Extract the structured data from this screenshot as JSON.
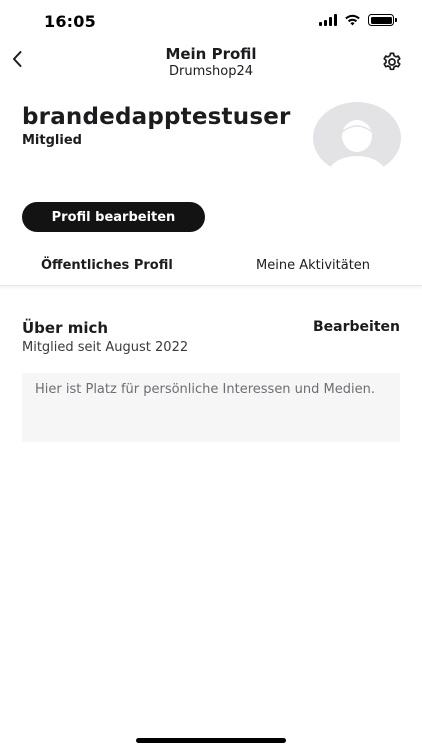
{
  "status_bar": {
    "time": "16:05",
    "battery_fill": 1.0
  },
  "nav": {
    "title": "Mein Profil",
    "subtitle": "Drumshop24",
    "back_icon": "chevron-left-icon",
    "settings_icon": "gear-icon"
  },
  "profile": {
    "username": "brandedapptestuser",
    "role": "Mitglied",
    "avatar_icon": "avatar-placeholder-icon",
    "edit_button_label": "Profil bearbeiten"
  },
  "tabs": [
    {
      "label": "Öffentliches Profil",
      "selected": true
    },
    {
      "label": "Meine Aktivitäten",
      "selected": false
    }
  ],
  "about": {
    "title": "Über mich",
    "edit_label": "Bearbeiten",
    "member_since": "Mitglied seit August 2022",
    "placeholder_text": "Hier ist Platz für persönliche Interessen und Medien."
  },
  "colors": {
    "primary_button": "#131313",
    "avatar_bg": "#e3e3e6",
    "about_box_bg": "#f6f6f7"
  }
}
